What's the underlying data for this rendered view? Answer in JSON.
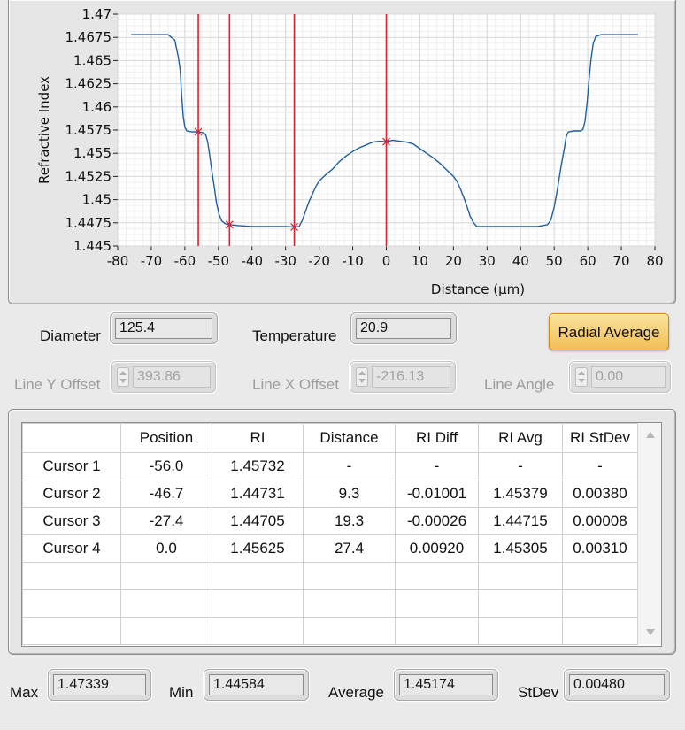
{
  "chart_data": {
    "type": "line",
    "xlabel": "Distance (µm)",
    "ylabel": "Refractive Index",
    "xlim": [
      -80,
      80
    ],
    "ylim": [
      1.445,
      1.47
    ],
    "x_ticks": [
      "-80",
      "-70",
      "-60",
      "-50",
      "-40",
      "-30",
      "-20",
      "-10",
      "0",
      "10",
      "20",
      "30",
      "40",
      "50",
      "60",
      "70",
      "80"
    ],
    "y_ticks": [
      "1.47",
      "1.4675",
      "1.465",
      "1.4625",
      "1.46",
      "1.4575",
      "1.455",
      "1.4525",
      "1.45",
      "1.4475",
      "1.445"
    ],
    "grid": true,
    "line_color": "#1f5fa0",
    "cursor_color": "#e0202a",
    "series": [
      {
        "points": [
          [
            -76,
            1.4678
          ],
          [
            -65,
            1.4678
          ],
          [
            -63,
            1.4672
          ],
          [
            -62,
            1.4655
          ],
          [
            -61.4,
            1.464
          ],
          [
            -61,
            1.4615
          ],
          [
            -60.5,
            1.459
          ],
          [
            -60,
            1.4578
          ],
          [
            -59.4,
            1.4574
          ],
          [
            -58,
            1.4573
          ],
          [
            -56,
            1.45732
          ],
          [
            -54.5,
            1.4572
          ],
          [
            -53.8,
            1.457
          ],
          [
            -53.2,
            1.4562
          ],
          [
            -52.6,
            1.4548
          ],
          [
            -52,
            1.4532
          ],
          [
            -51.3,
            1.4515
          ],
          [
            -50.6,
            1.4497
          ],
          [
            -49.8,
            1.4484
          ],
          [
            -49,
            1.4477
          ],
          [
            -48,
            1.4474
          ],
          [
            -46.7,
            1.44731
          ],
          [
            -44,
            1.4472
          ],
          [
            -40,
            1.4471
          ],
          [
            -35,
            1.4471
          ],
          [
            -30,
            1.4471
          ],
          [
            -27.4,
            1.44705
          ],
          [
            -26,
            1.4471
          ],
          [
            -25,
            1.4478
          ],
          [
            -24,
            1.4488
          ],
          [
            -23,
            1.4498
          ],
          [
            -22,
            1.4506
          ],
          [
            -21,
            1.4514
          ],
          [
            -20,
            1.452
          ],
          [
            -18,
            1.4527
          ],
          [
            -16,
            1.4533
          ],
          [
            -14,
            1.4541
          ],
          [
            -12,
            1.4547
          ],
          [
            -10,
            1.4552
          ],
          [
            -8,
            1.4556
          ],
          [
            -6,
            1.4559
          ],
          [
            -4,
            1.4562
          ],
          [
            -2,
            1.4563
          ],
          [
            0,
            1.45625
          ],
          [
            2,
            1.4564
          ],
          [
            4,
            1.4563
          ],
          [
            6,
            1.4562
          ],
          [
            8,
            1.456
          ],
          [
            10,
            1.4555
          ],
          [
            12,
            1.455
          ],
          [
            14,
            1.4545
          ],
          [
            16,
            1.4539
          ],
          [
            18,
            1.4532
          ],
          [
            20,
            1.4525
          ],
          [
            21,
            1.452
          ],
          [
            22,
            1.4512
          ],
          [
            23,
            1.4503
          ],
          [
            24,
            1.4493
          ],
          [
            25,
            1.4482
          ],
          [
            26,
            1.4475
          ],
          [
            27,
            1.4471
          ],
          [
            30,
            1.4471
          ],
          [
            35,
            1.4471
          ],
          [
            40,
            1.4471
          ],
          [
            45,
            1.4471
          ],
          [
            48,
            1.4473
          ],
          [
            49,
            1.4478
          ],
          [
            50,
            1.4492
          ],
          [
            51,
            1.4512
          ],
          [
            52,
            1.4535
          ],
          [
            53,
            1.4555
          ],
          [
            53.6,
            1.4568
          ],
          [
            54.2,
            1.4573
          ],
          [
            56,
            1.4574
          ],
          [
            58,
            1.4574
          ],
          [
            58.6,
            1.4576
          ],
          [
            59.2,
            1.4585
          ],
          [
            59.8,
            1.4605
          ],
          [
            60.4,
            1.463
          ],
          [
            61,
            1.4652
          ],
          [
            61.6,
            1.4668
          ],
          [
            62.4,
            1.4676
          ],
          [
            64,
            1.4678
          ],
          [
            75,
            1.4678
          ]
        ]
      }
    ],
    "cursors": [
      {
        "x": -56.0,
        "y": 1.45732
      },
      {
        "x": -46.7,
        "y": 1.44731
      },
      {
        "x": -27.4,
        "y": 1.44705
      },
      {
        "x": 0.0,
        "y": 1.45625
      }
    ]
  },
  "controls": {
    "diameter_label": "Diameter",
    "diameter_value": "125.4",
    "temperature_label": "Temperature",
    "temperature_value": "20.9",
    "radial_average_label": "Radial Average",
    "line_y_offset_label": "Line Y Offset",
    "line_y_offset_value": "393.86",
    "line_x_offset_label": "Line X Offset",
    "line_x_offset_value": "-216.13",
    "line_angle_label": "Line Angle",
    "line_angle_value": "0.00"
  },
  "table": {
    "headers": [
      "",
      "Position",
      "RI",
      "Distance",
      "RI Diff",
      "RI Avg",
      "RI StDev"
    ],
    "rows": [
      [
        "Cursor 1",
        "-56.0",
        "1.45732",
        "-",
        "-",
        "-",
        "-"
      ],
      [
        "Cursor 2",
        "-46.7",
        "1.44731",
        "9.3",
        "-0.01001",
        "1.45379",
        "0.00380"
      ],
      [
        "Cursor 3",
        "-27.4",
        "1.44705",
        "19.3",
        "-0.00026",
        "1.44715",
        "0.00008"
      ],
      [
        "Cursor 4",
        "0.0",
        "1.45625",
        "27.4",
        "0.00920",
        "1.45305",
        "0.00310"
      ],
      [
        "",
        "",
        "",
        "",
        "",
        "",
        ""
      ],
      [
        "",
        "",
        "",
        "",
        "",
        "",
        ""
      ],
      [
        "",
        "",
        "",
        "",
        "",
        "",
        ""
      ]
    ]
  },
  "stats": {
    "max_label": "Max",
    "max_value": "1.47339",
    "min_label": "Min",
    "min_value": "1.44584",
    "average_label": "Average",
    "average_value": "1.45174",
    "stdev_label": "StDev",
    "stdev_value": "0.00480"
  }
}
